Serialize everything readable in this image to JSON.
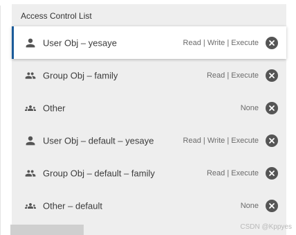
{
  "panel": {
    "title": "Access Control List"
  },
  "entries": [
    {
      "icon": "user-icon",
      "name": "User Obj – yesaye",
      "permissions": "Read | Write | Execute",
      "selected": true
    },
    {
      "icon": "group-icon",
      "name": "Group Obj – family",
      "permissions": "Read | Execute",
      "selected": false
    },
    {
      "icon": "other-users-icon",
      "name": "Other",
      "permissions": "None",
      "selected": false
    },
    {
      "icon": "user-icon",
      "name": "User Obj – default – yesaye",
      "permissions": "Read | Write | Execute",
      "selected": false
    },
    {
      "icon": "group-icon",
      "name": "Group Obj – default – family",
      "permissions": "Read | Execute",
      "selected": false
    },
    {
      "icon": "other-users-icon",
      "name": "Other – default",
      "permissions": "None",
      "selected": false
    }
  ],
  "remove_icon": "close-circle-icon",
  "watermark": "CSDN @Kppyes",
  "colors": {
    "panel_bg": "#eeeeee",
    "selected_accent": "#1b5b9a",
    "icon_color": "#555555",
    "text_color": "#3c3c3c",
    "permission_color": "#6b6b6b"
  }
}
